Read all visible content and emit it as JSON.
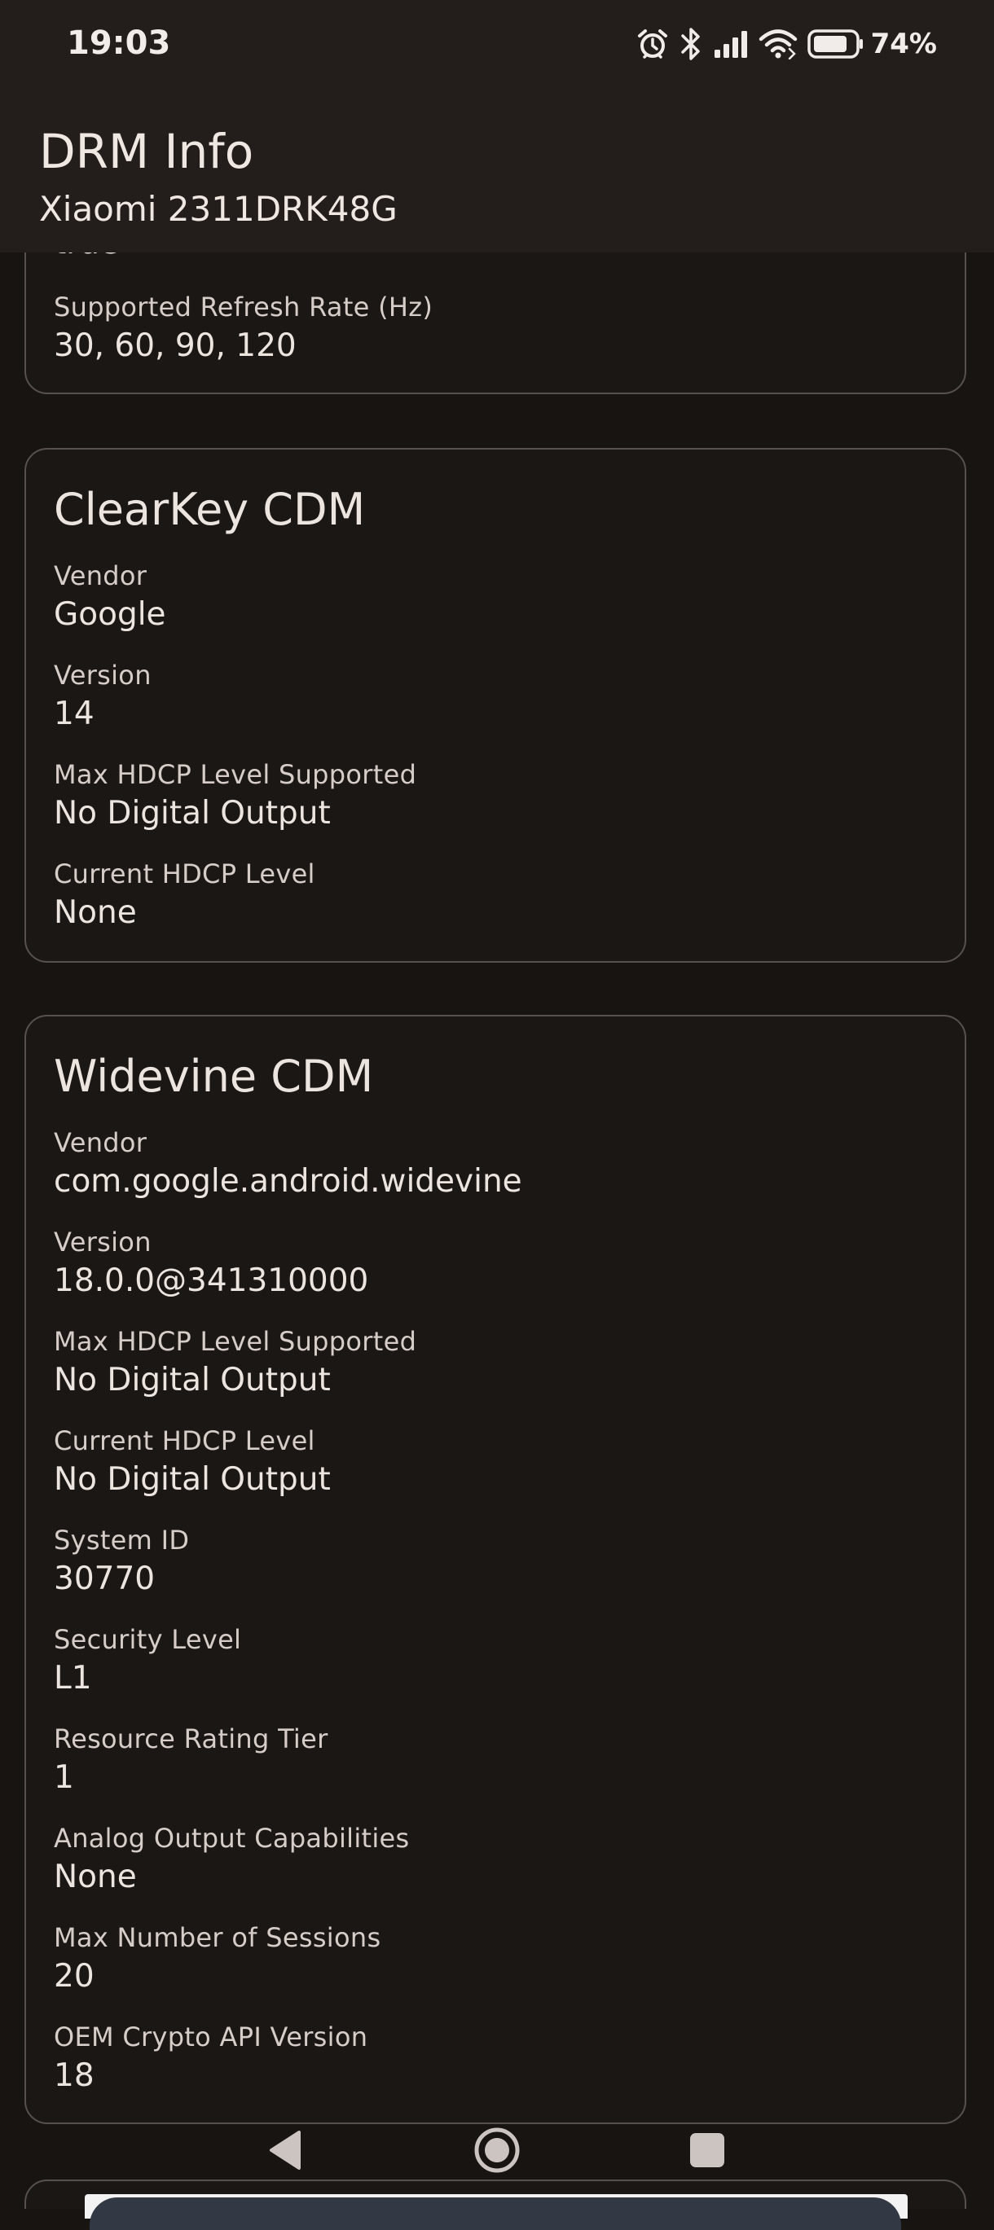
{
  "status_bar": {
    "time": "19:03",
    "battery_percent": "74%",
    "icons": [
      "alarm-icon",
      "bluetooth-icon",
      "signal-icon",
      "wifi-icon",
      "battery-icon"
    ]
  },
  "app_bar": {
    "title": "DRM Info",
    "subtitle": "Xiaomi 2311DRK48G"
  },
  "display_card": {
    "partial_value": "true",
    "fields": [
      {
        "label": "Supported Refresh Rate (Hz)",
        "value": "30, 60, 90, 120"
      }
    ]
  },
  "clearkey_card": {
    "title": "ClearKey CDM",
    "fields": [
      {
        "label": "Vendor",
        "value": "Google"
      },
      {
        "label": "Version",
        "value": "14"
      },
      {
        "label": "Max HDCP Level Supported",
        "value": "No Digital Output"
      },
      {
        "label": "Current HDCP Level",
        "value": "None"
      }
    ]
  },
  "widevine_card": {
    "title": "Widevine CDM",
    "fields": [
      {
        "label": "Vendor",
        "value": "com.google.android.widevine"
      },
      {
        "label": "Version",
        "value": "18.0.0@341310000"
      },
      {
        "label": "Max HDCP Level Supported",
        "value": "No Digital Output"
      },
      {
        "label": "Current HDCP Level",
        "value": "No Digital Output"
      },
      {
        "label": "System ID",
        "value": "30770"
      },
      {
        "label": "Security Level",
        "value": "L1"
      },
      {
        "label": "Resource Rating Tier",
        "value": "1"
      },
      {
        "label": "Analog Output Capabilities",
        "value": "None"
      },
      {
        "label": "Max Number of Sessions",
        "value": "20"
      },
      {
        "label": "OEM Crypto API Version",
        "value": "18"
      }
    ]
  },
  "nav_bar": {
    "buttons": [
      "back-icon",
      "home-icon",
      "recents-icon"
    ]
  },
  "colors": {
    "background": "#181412",
    "app_bar": "#231e1c",
    "card_border": "#57504d",
    "text_primary": "#ece4df",
    "text_secondary": "#d6cdc8"
  }
}
